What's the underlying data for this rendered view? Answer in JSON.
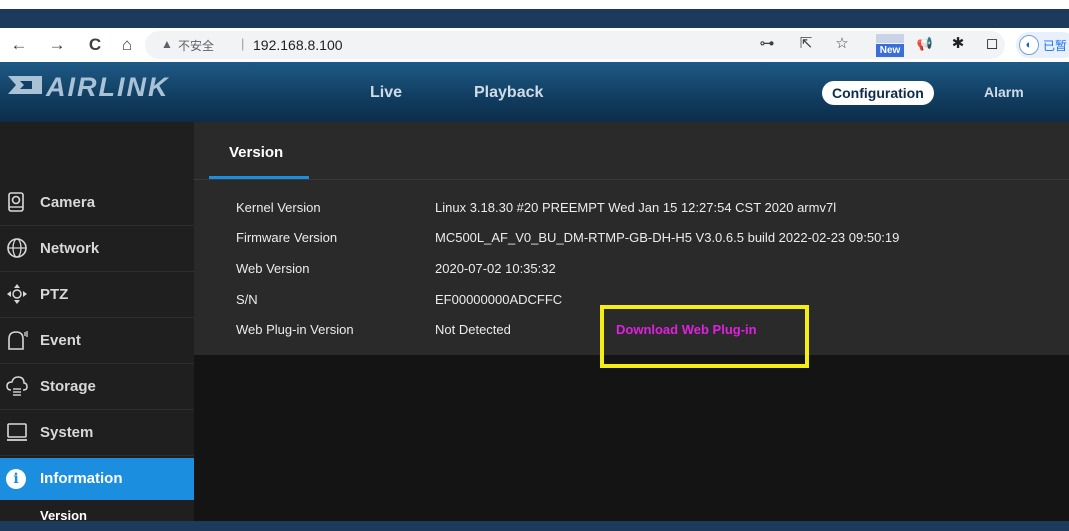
{
  "browser": {
    "nav": {
      "back": "←",
      "forward": "→",
      "reload": "C",
      "home": "⌂"
    },
    "security_warning": "▲",
    "insecure_label": "不安全",
    "separator": "|",
    "url": "192.168.8.100",
    "extensions": {
      "key": "⊶",
      "share": "⇱",
      "star": "☆",
      "new_badge": "New",
      "megaphone": "📢",
      "puzzle": "✱",
      "window": "◻"
    },
    "profile_label": "已暂"
  },
  "header": {
    "logo_text": "AIRLINK",
    "nav": [
      "Live",
      "Playback",
      "Configuration",
      "Alarm"
    ],
    "active_nav": "Configuration"
  },
  "sidebar": {
    "items": [
      {
        "label": "Camera",
        "icon": "camera-icon"
      },
      {
        "label": "Network",
        "icon": "network-icon"
      },
      {
        "label": "PTZ",
        "icon": "ptz-icon"
      },
      {
        "label": "Event",
        "icon": "event-icon"
      },
      {
        "label": "Storage",
        "icon": "storage-icon"
      },
      {
        "label": "System",
        "icon": "system-icon"
      }
    ],
    "active": {
      "label": "Information",
      "icon": "info-icon",
      "icon_glyph": "i"
    },
    "sub_item": "Version"
  },
  "main": {
    "tab": "Version",
    "rows": [
      {
        "label": "Kernel Version",
        "value": "Linux 3.18.30 #20 PREEMPT Wed Jan 15 12:27:54 CST 2020 armv7l"
      },
      {
        "label": "Firmware Version",
        "value": "MC500L_AF_V0_BU_DM-RTMP-GB-DH-H5 V3.0.6.5 build 2022-02-23 09:50:19"
      },
      {
        "label": "Web Version",
        "value": "2020-07-02 10:35:32"
      },
      {
        "label": "S/N",
        "value": "EF00000000ADCFFC"
      },
      {
        "label": "Web Plug-in Version",
        "value": "Not Detected"
      }
    ],
    "plugin_link": "Download Web Plug-in"
  },
  "colors": {
    "header": "#123f63",
    "accent": "#1b8ee0",
    "highlight_box": "#f4ee14",
    "link": "#e020e0"
  }
}
